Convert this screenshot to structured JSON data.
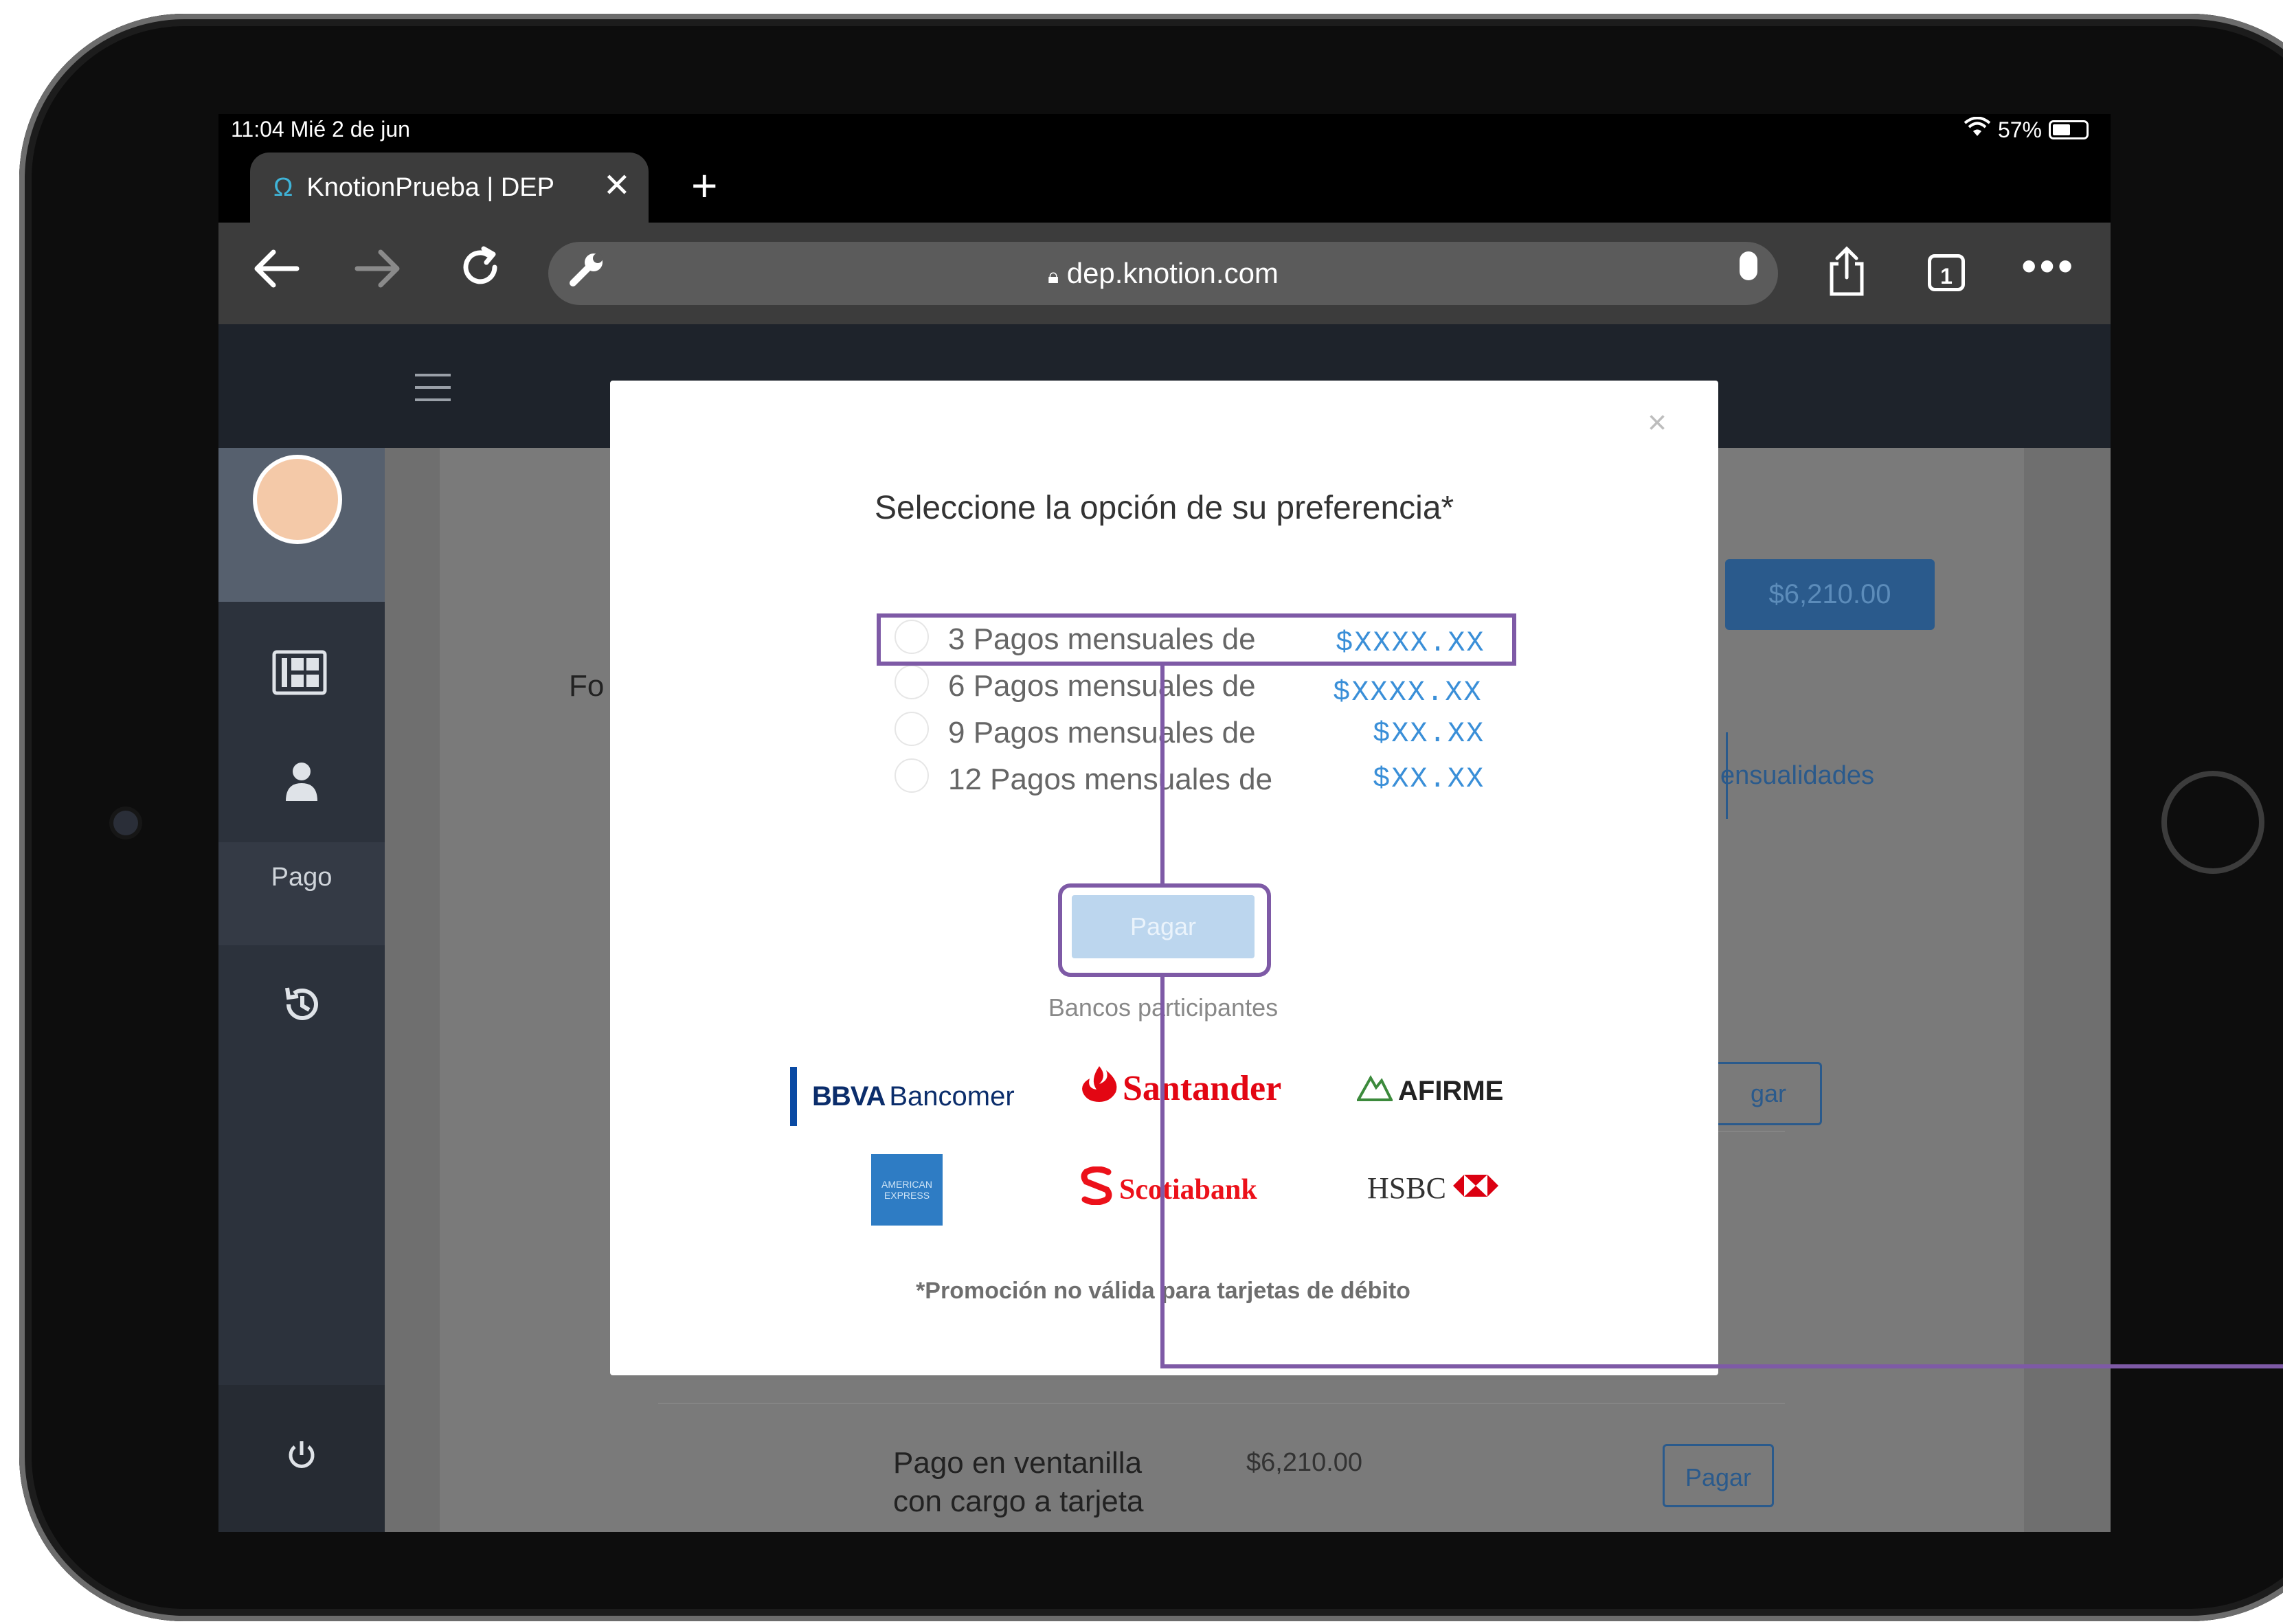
{
  "status": {
    "time_date": "11:04  Mié 2 de jun",
    "battery": "57%"
  },
  "browser": {
    "tab_title": "KnotionPrueba | DEP",
    "tab_close": "✕",
    "new_tab": "+",
    "url": "dep.knotion.com",
    "tab_count": "1",
    "more": "•••"
  },
  "sidebar": {
    "pay_label": "Pago"
  },
  "background_page": {
    "amount_button": "$6,210.00",
    "partial_label_left": "Fo",
    "mensualidades_btn": "ensualidades",
    "pagar_partial": "gar",
    "row_title": "Pago en ventanilla con cargo a tarjeta",
    "row_title_line1": "Pago en ventanilla",
    "row_title_line2": "con cargo a tarjeta",
    "row_amount": "$6,210.00",
    "row_button": "Pagar"
  },
  "modal": {
    "close": "×",
    "title": "Seleccione la opción de su preferencia*",
    "options": [
      {
        "label": "3 Pagos mensuales de",
        "price": "$XXXX.XX"
      },
      {
        "label": "6 Pagos mensuales de",
        "price": "$XXXX.XX"
      },
      {
        "label": "9 Pagos mensuales de",
        "price": "$XX.XX"
      },
      {
        "label": "12 Pagos mensuales de",
        "price": "$XX.XX"
      }
    ],
    "pay_button": "Pagar",
    "banks_label": "Bancos participantes",
    "banks": {
      "bbva_bold": "BBVA",
      "bbva_rest": "Bancomer",
      "santander": "Santander",
      "afirme": "AFIRME",
      "amex": "AMERICAN EXPRESS",
      "scotiabank": "Scotiabank",
      "hsbc": "HSBC"
    },
    "promo": "*Promoción no válida para tarjetas de débito"
  },
  "colors": {
    "highlight": "#7e5aa6",
    "price": "#3a8fd8",
    "header": "#1e232b"
  }
}
